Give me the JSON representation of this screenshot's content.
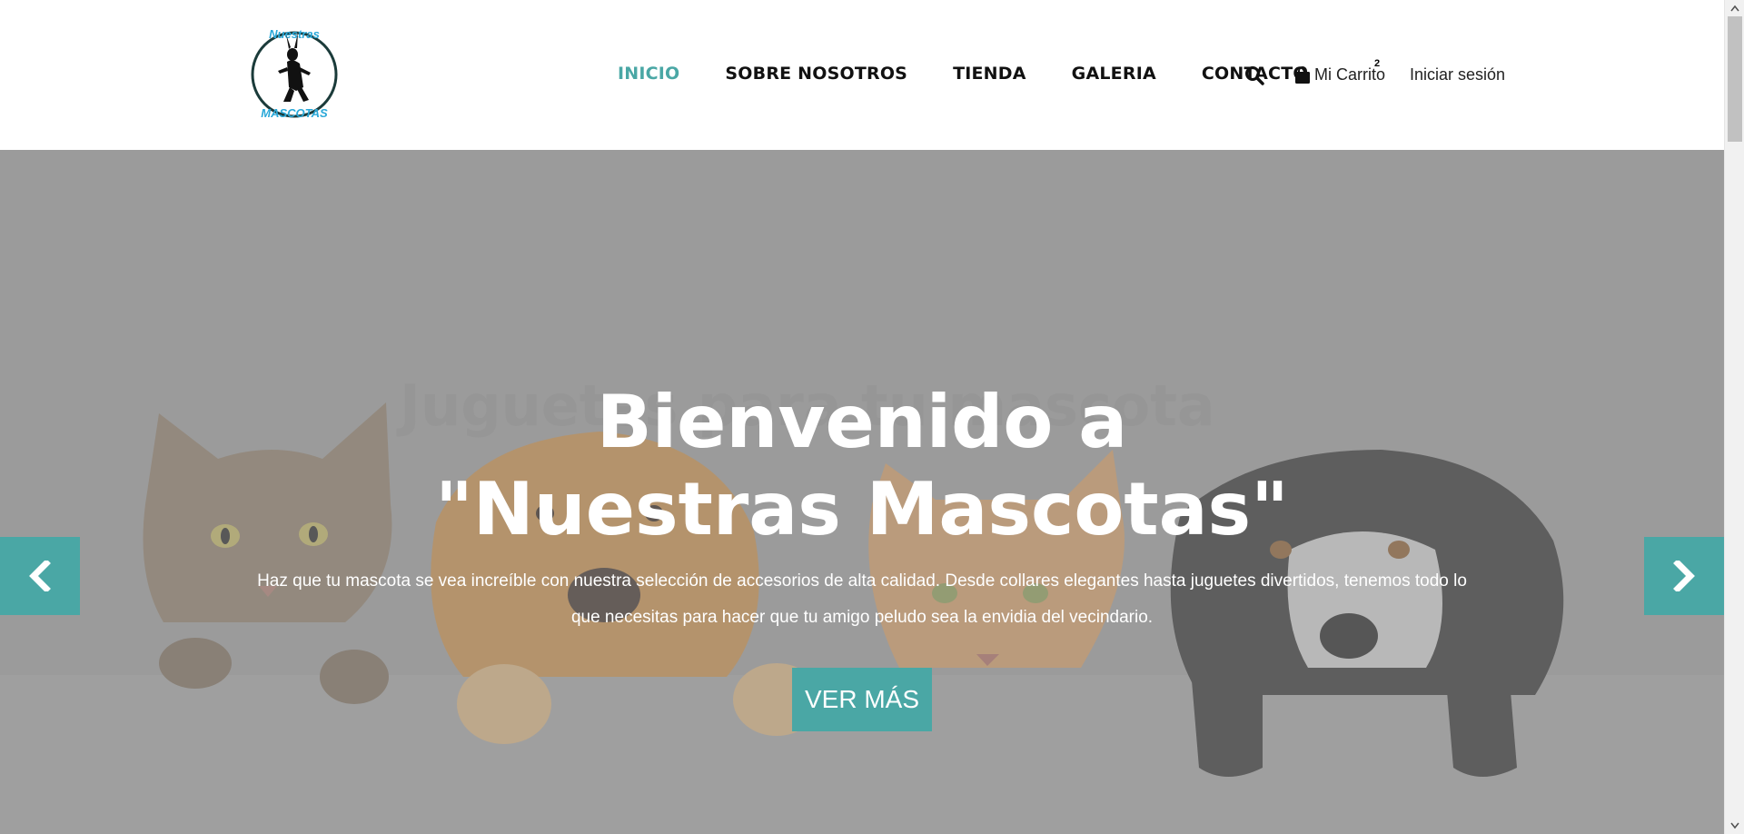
{
  "header": {
    "logo_alt": "Nuestras Mascotas",
    "logo_text_top": "Nuestras",
    "logo_text_bottom": "MASCOTAS",
    "nav": [
      {
        "label": "INICIO",
        "active": true
      },
      {
        "label": "SOBRE NOSOTROS",
        "active": false
      },
      {
        "label": "TIENDA",
        "active": false
      },
      {
        "label": "GALERIA",
        "active": false
      },
      {
        "label": "CONTACTO",
        "active": false
      }
    ],
    "search_icon": "search-icon",
    "cart_label": "Mi Carrito",
    "cart_count": "2",
    "login_label": "Iniciar sesión"
  },
  "hero": {
    "ghost_text": "Juguetes para tu mascota",
    "title_line1": "Bienvenido a",
    "title_line2": "\"Nuestras Mascotas\"",
    "text": "Haz que tu mascota se vea increíble con nuestra selección de accesorios de alta calidad. Desde collares elegantes hasta juguetes divertidos, tenemos todo lo que necesitas para hacer que tu amigo peludo sea la envidia del vecindario.",
    "cta_label": "VER MÁS",
    "prev_icon": "chevron-left-icon",
    "next_icon": "chevron-right-icon"
  },
  "colors": {
    "accent": "#4aa7a5",
    "hero_bg": "#9b9b9b",
    "nav_text": "#111111"
  }
}
